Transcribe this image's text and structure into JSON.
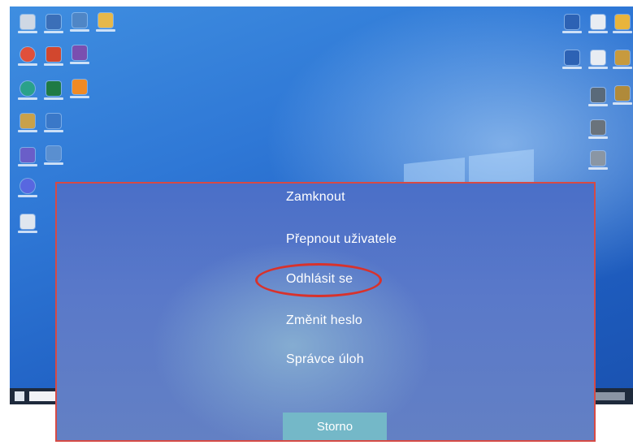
{
  "menu": {
    "lock_label": "Zamknout",
    "switch_user_label": "Přepnout uživatele",
    "sign_out_label": "Odhlásit se",
    "change_password_label": "Změnit heslo",
    "task_manager_label": "Správce úloh"
  },
  "cancel_label": "Storno",
  "colors": {
    "highlight": "#d8322c",
    "overlay_border": "#d64a45",
    "cancel_button": "#74b8c8"
  },
  "desktop_icons": [
    "recycle-bin-icon",
    "pc-icon",
    "control-panel-icon",
    "folder-icon",
    "chrome-icon",
    "powerpoint-icon",
    "app-icon",
    "edge-icon",
    "excel-icon",
    "vlc-icon",
    "file-icon",
    "skype-icon",
    "teams-icon",
    "network-icon",
    "discord-icon",
    "document-icon",
    "word-doc-icon",
    "settings-icon",
    "yellow-file-icon",
    "word-doc-icon",
    "settings-icon",
    "archive-icon",
    "folder-icon",
    "archive-icon",
    "folder-icon",
    "drive-icon"
  ]
}
